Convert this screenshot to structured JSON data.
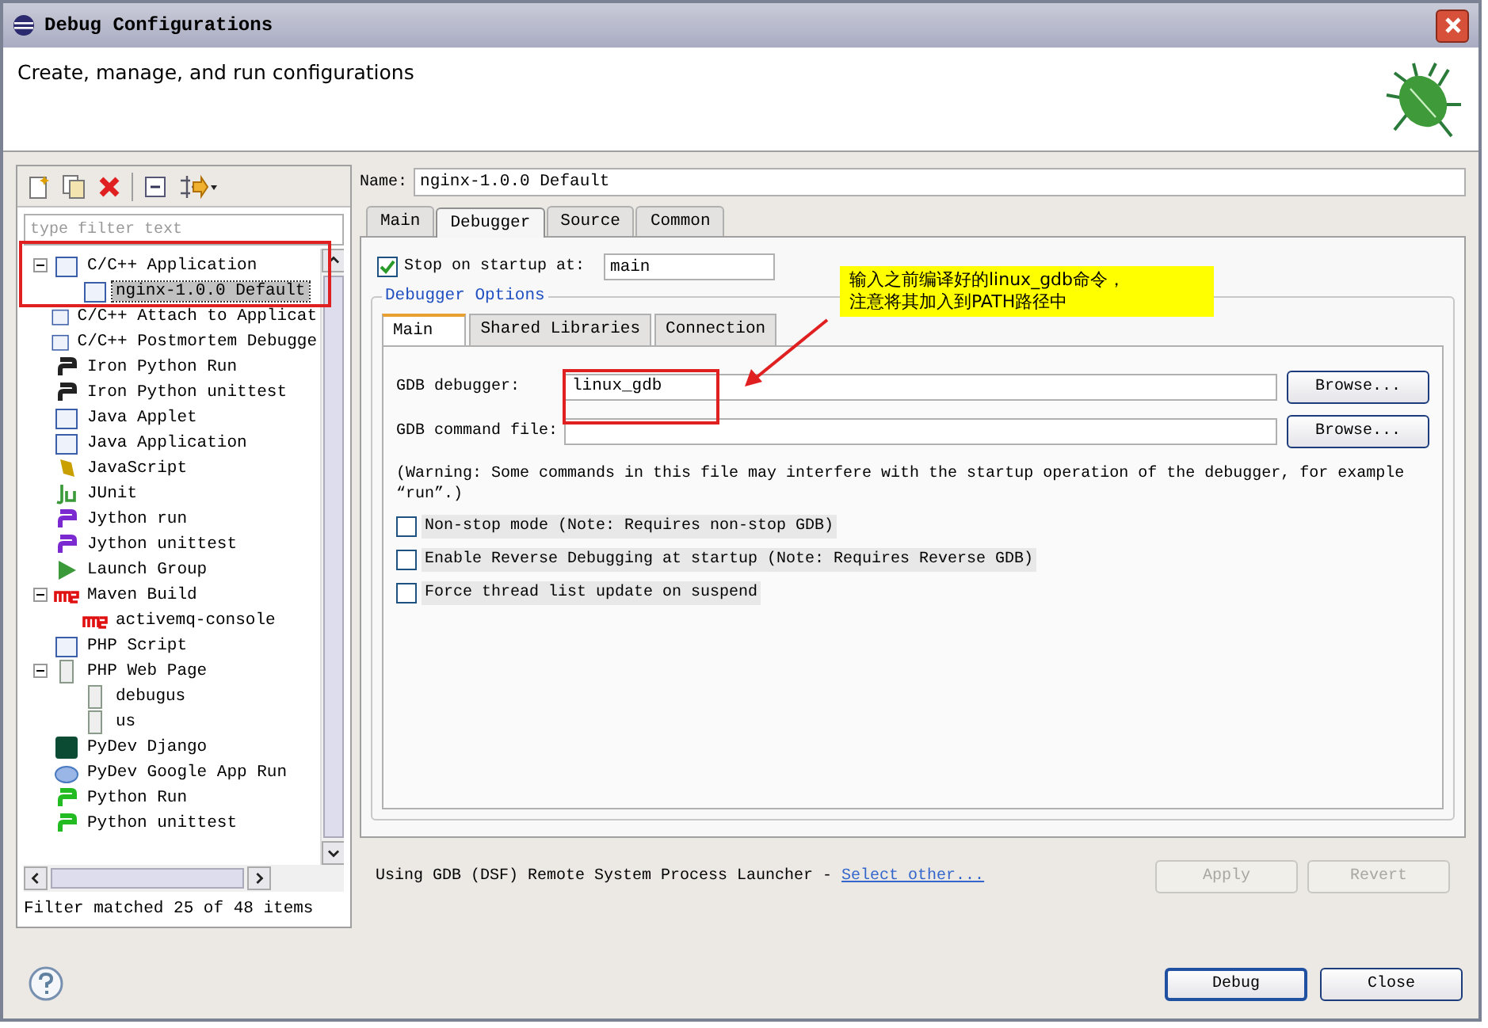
{
  "window": {
    "title": "Debug Configurations"
  },
  "header": {
    "message": "Create, manage, and run configurations"
  },
  "sidebar": {
    "filter": {
      "placeholder": "type filter text"
    },
    "tree": [
      {
        "label": "C/C++ Application",
        "kind": "c",
        "expanded": true,
        "selected": false,
        "children": [
          {
            "label": "nginx-1.0.0 Default",
            "kind": "c",
            "selected": true
          }
        ]
      },
      {
        "label": "C/C++ Attach to Applicat",
        "kind": "c",
        "selected": false
      },
      {
        "label": "C/C++ Postmortem Debugge",
        "kind": "c",
        "selected": false
      },
      {
        "label": "Iron Python Run",
        "kind": "python",
        "selected": false
      },
      {
        "label": "Iron Python unittest",
        "kind": "python",
        "selected": false
      },
      {
        "label": "Java Applet",
        "kind": "java",
        "selected": false
      },
      {
        "label": "Java Application",
        "kind": "java",
        "selected": false
      },
      {
        "label": "JavaScript",
        "kind": "js",
        "selected": false
      },
      {
        "label": "JUnit",
        "kind": "junit",
        "selected": false
      },
      {
        "label": "Jython run",
        "kind": "jython",
        "selected": false
      },
      {
        "label": "Jython unittest",
        "kind": "jython",
        "selected": false
      },
      {
        "label": "Launch Group",
        "kind": "launch",
        "selected": false
      },
      {
        "label": "Maven Build",
        "kind": "maven",
        "expanded": true,
        "selected": false,
        "children": [
          {
            "label": "activemq-console",
            "kind": "maven",
            "selected": false
          }
        ]
      },
      {
        "label": "PHP Script",
        "kind": "php",
        "selected": false
      },
      {
        "label": "PHP Web Page",
        "kind": "page",
        "expanded": true,
        "selected": false,
        "children": [
          {
            "label": "debugus",
            "kind": "page",
            "selected": false
          },
          {
            "label": "us",
            "kind": "page",
            "selected": false
          }
        ]
      },
      {
        "label": "PyDev Django",
        "kind": "django",
        "selected": false
      },
      {
        "label": "PyDev Google App Run",
        "kind": "gae",
        "selected": false
      },
      {
        "label": "Python Run",
        "kind": "pyrun",
        "selected": false
      },
      {
        "label": "Python unittest",
        "kind": "pyrun",
        "selected": false
      }
    ],
    "status": "Filter matched 25 of 48 items"
  },
  "config": {
    "name_label": "Name:",
    "name": "nginx-1.0.0 Default",
    "tabs": [
      {
        "label": "Main",
        "selected": false
      },
      {
        "label": "Debugger",
        "selected": true
      },
      {
        "label": "Source",
        "selected": false
      },
      {
        "label": "Common",
        "selected": false
      }
    ],
    "stop_on_startup": {
      "label": "Stop on startup at:",
      "checked": true,
      "value": "main"
    },
    "debugger_options": {
      "title": "Debugger Options",
      "tabs": [
        {
          "label": "Main",
          "selected": true
        },
        {
          "label": "Shared Libraries",
          "selected": false
        },
        {
          "label": "Connection",
          "selected": false
        }
      ],
      "fields": [
        {
          "label": "GDB debugger:",
          "value": "linux_gdb",
          "button": "Browse..."
        },
        {
          "label": "GDB command file:",
          "button": "Browse..."
        }
      ],
      "warning": "(Warning: Some commands in this file may interfere with the startup operation of the debugger, for example “run”.)",
      "options": [
        {
          "label": "Non-stop mode (Note: Requires non-stop GDB)",
          "checked": false
        },
        {
          "label": "Enable Reverse Debugging at startup (Note: Requires Reverse GDB)",
          "checked": false
        },
        {
          "label": "Force thread list update on suspend",
          "checked": false
        }
      ]
    },
    "launcher": {
      "text": "Using GDB (DSF) Remote System Process Launcher -",
      "link": "Select other..."
    },
    "actions": [
      {
        "label": "Apply",
        "disabled": true
      },
      {
        "label": "Revert",
        "disabled": true
      }
    ]
  },
  "footer_buttons": [
    {
      "label": "Debug",
      "default": true
    },
    {
      "label": "Close",
      "default": false
    }
  ],
  "annotation": {
    "callout": [
      "输入之前编译好的linux_gdb命令，",
      "注意将其加入到PATH路径中"
    ]
  }
}
